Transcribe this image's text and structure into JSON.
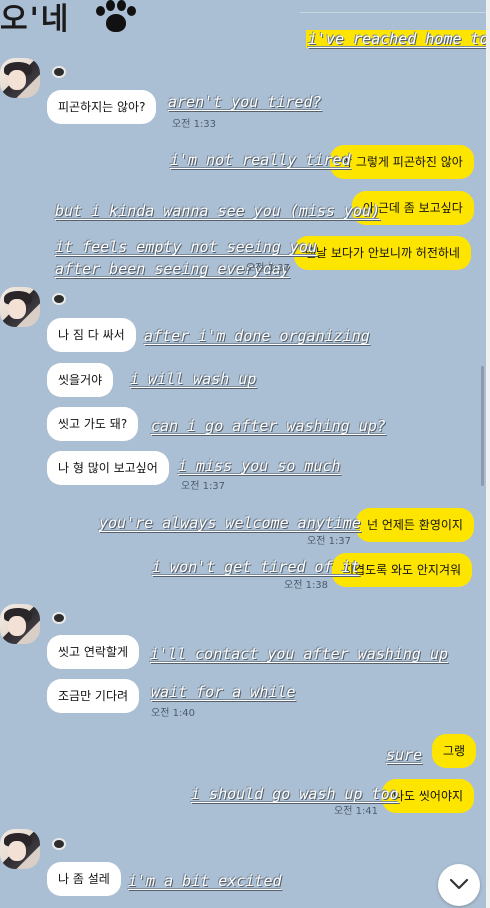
{
  "header": {
    "title": "오'네"
  },
  "messages": {
    "m0_cap": "i've reached home too",
    "m1_text": "피곤하지는 않아?",
    "m1_cap": "aren't you tired?",
    "m1_time": "오전 1:33",
    "m2_text": "막 그렇게 피곤하진 않아",
    "m2_cap": "i'm not really tired",
    "m3_text": "아 근데 좀 보고싶다",
    "m3_cap": "but i kinda wanna see you (miss you)",
    "m4_text": "맨날 보다가 안보니까 허전하네",
    "m4_cap1": "it feels empty not seeing you",
    "m4_cap2": "after been seeing everyday",
    "m4_time": "오전 1:37",
    "m5_text": "나 짐 다 싸서",
    "m5_cap": "after i'm done organizing",
    "m6_text": "씻을거야",
    "m6_cap": "i will wash up",
    "m7_text": "씻고 가도 돼?",
    "m7_cap": "can i go after washing up?",
    "m8_text": "나 형 많이 보고싶어",
    "m8_cap": "i miss you so much",
    "m8_time": "오전 1:37",
    "m9_text": "넌 언제든 환영이지",
    "m9_cap": "you're always welcome anytime",
    "m9_time": "오전 1:37",
    "m10_text": "지겹도록 와도 안지겨워",
    "m10_cap": "i won't get tired of it",
    "m10_time": "오전 1:38",
    "m11_text": "씻고 연락할게",
    "m11_cap": "i'll contact you after washing up",
    "m12_text": "조금만 기다려",
    "m12_cap": "wait for a while",
    "m12_time": "오전 1:40",
    "m13_text": "그랭",
    "m13_cap": "sure",
    "m14_text": "나도 씻어야지",
    "m14_cap": "i should go wash up too",
    "m14_time": "오전 1:41",
    "m15_text": "나 좀 설레",
    "m15_cap": "i'm a bit excited"
  },
  "icons": {
    "paw": "paw-icon",
    "scroll_down": "chevron-down-icon",
    "nickname_badge": "profile-badge-icon"
  },
  "colors": {
    "background": "#abbfd4",
    "incoming_bubble": "#ffffff",
    "outgoing_bubble": "#fee500"
  }
}
